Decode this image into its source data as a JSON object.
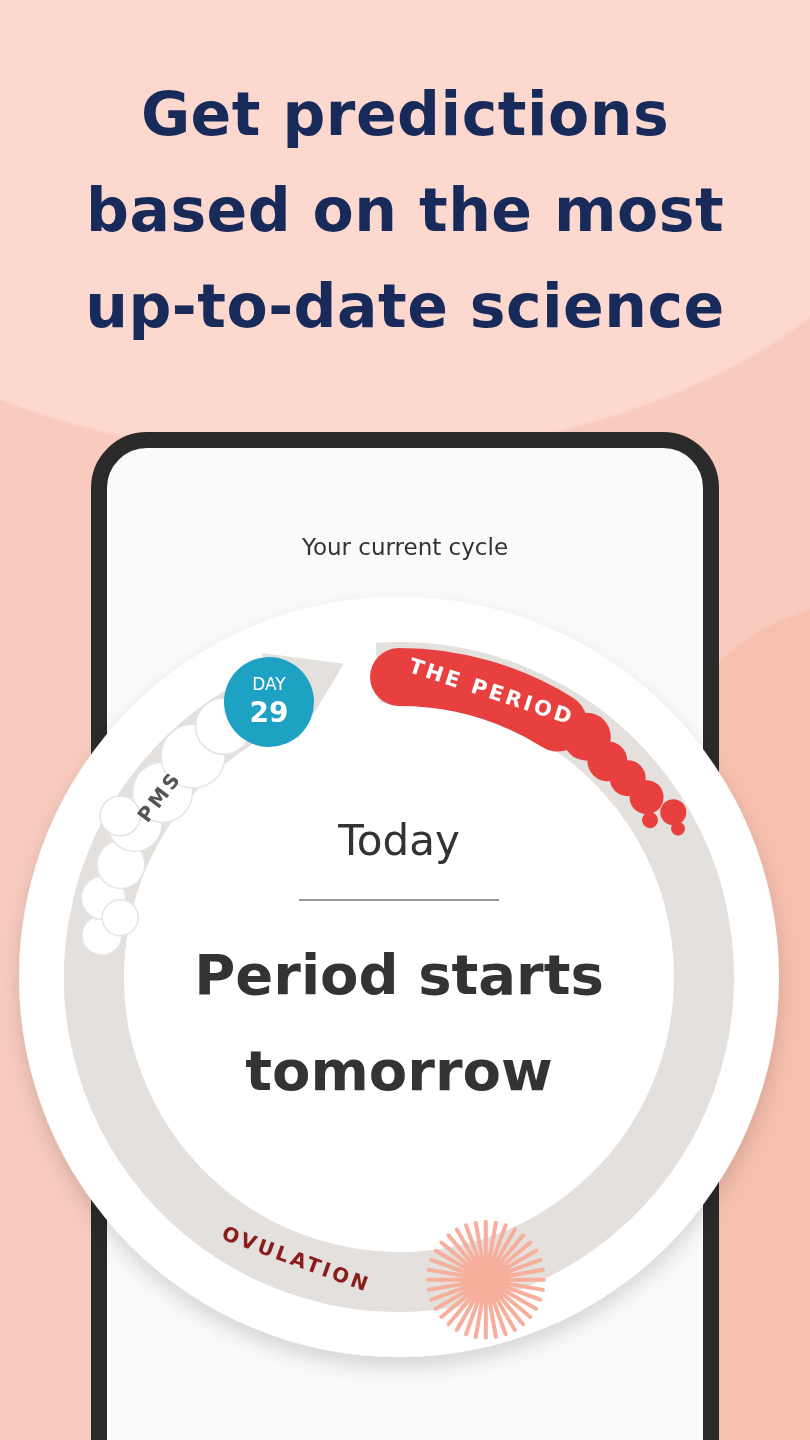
{
  "headline": "Get predictions based on the most up-to-date science",
  "screen": {
    "title": "Your current cycle",
    "wheel": {
      "day_badge": {
        "label": "DAY",
        "value": "29"
      },
      "phases": [
        {
          "kind": "pms",
          "label": "PMS"
        },
        {
          "kind": "period",
          "label": "THE PERIOD"
        },
        {
          "kind": "ovulation",
          "label": "OVULATION"
        }
      ],
      "today_label": "Today",
      "prediction": "Period starts tomorrow"
    }
  }
}
